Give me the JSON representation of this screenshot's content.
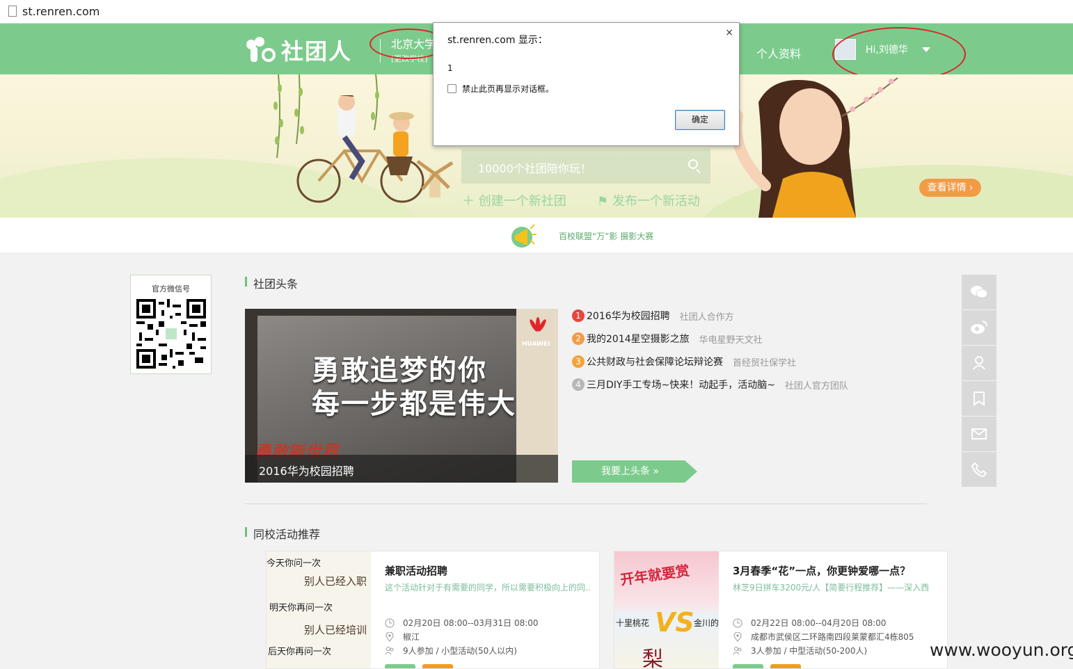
{
  "browser": {
    "url": "st.renren.com"
  },
  "header": {
    "logo_text": "社团人",
    "school_name": "北京大学",
    "change_school": "[更改学校]",
    "nav_profile": "个人资料",
    "user_greeting": "Hi,刘德华"
  },
  "banner": {
    "search_placeholder": "10000个社团陪你玩！",
    "create_label": "创建一个新社团",
    "publish_label": "发布一个新活动",
    "detail_button": "查看详情 ›"
  },
  "notice": {
    "text": "百校联盟“万”影 摄影大赛"
  },
  "wechat": {
    "title": "官方微信号"
  },
  "headlines": {
    "section_title": "社团头条",
    "feature_caption": "2016华为校园招聘",
    "feature_line1": "勇敢追梦的你",
    "feature_line2": "每一步都是伟大",
    "feature_brand": "勇敢新世界",
    "feature_logo": "HUAWEI",
    "items": [
      {
        "num": "1",
        "title": "2016华为校园招聘",
        "source": "社团人合作方",
        "color": "#e8453c"
      },
      {
        "num": "2",
        "title": "我的2014星空摄影之旅",
        "source": "华电星野天文社",
        "color": "#f29b47"
      },
      {
        "num": "3",
        "title": "公共财政与社会保障论坛辩论赛",
        "source": "首经贸社保学社",
        "color": "#f2a33a"
      },
      {
        "num": "4",
        "title": "三月DIY手工专场~快来！动起手，活动脑~",
        "source": "社团人官方团队",
        "color": "#b8b8b8"
      }
    ],
    "cta": "我要上头条 »"
  },
  "activities": {
    "section_title": "同校活动推荐",
    "cards": [
      {
        "title": "兼职活动招聘",
        "desc": "这个活动针对于有需要的同学，所以需要积极向上的同..",
        "time": "02月20日 08:00--03月31日 08:00",
        "place": "椒江",
        "people": "9人参加 / 小型活动(50人以内)",
        "thumb_lines": [
          "今天你问一次",
          "别人已经入职",
          "明天你再问一次",
          "别人已经培训",
          "后天你再问一次"
        ]
      },
      {
        "title": "3月春季“花”一点，你更钟爱哪一点？",
        "desc": "林芝9日拼车3200元/人【简要行程推荐】——深入西",
        "time": "02月22日 08:00--04月20日 08:00",
        "place": "成都市武侯区二环路南四段莱蒙都汇4栋805",
        "people": "3人参加 / 中型活动(50-200人)",
        "thumb_lines": [
          "开年就要赏",
          "十里桃花",
          "VS",
          "金川的",
          "梨"
        ]
      }
    ]
  },
  "dialog": {
    "title": "st.renren.com 显示：",
    "message": "1",
    "checkbox_label": "禁止此页再显示对话框。",
    "ok_button": "确定",
    "close": "×"
  },
  "watermark": "www.wooyun.org",
  "colors": {
    "brand_green": "#7ccb8c",
    "accent_orange": "#f29b47",
    "annotation_red": "#d9262b"
  }
}
